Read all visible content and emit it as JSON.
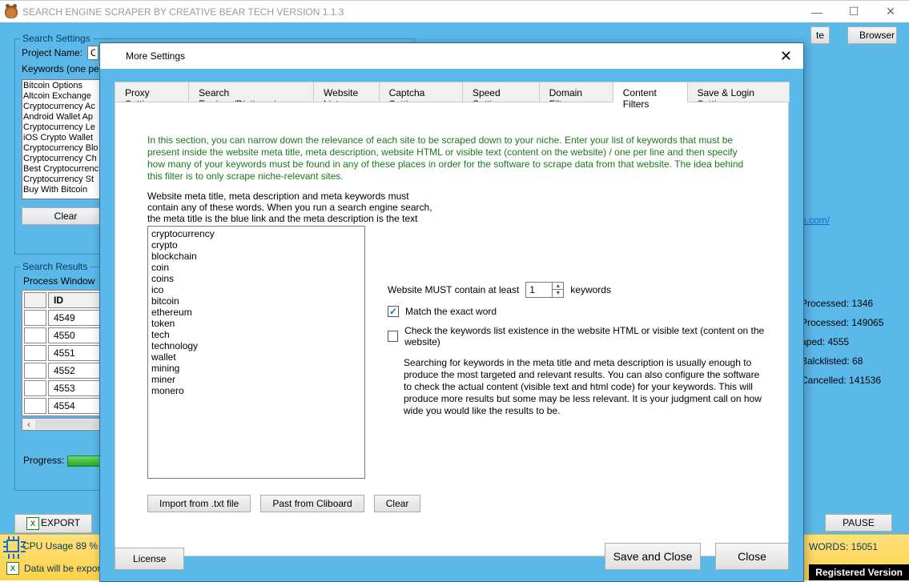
{
  "title": "SEARCH ENGINE SCRAPER BY CREATIVE BEAR TECH VERSION 1.1.3",
  "winbuttons": {
    "min": "—",
    "max": "☐",
    "close": "✕"
  },
  "topbuttons": {
    "te": "te",
    "browser": "Browser"
  },
  "search_settings": {
    "legend": "Search Settings",
    "project_label": "Project Name:",
    "project_value": "C",
    "keywords_label": "Keywords (one pe",
    "keywords": [
      "Bitcoin Options",
      "Altcoin Exchange",
      "Cryptocurrency Ac",
      "Android Wallet Ap",
      "Cryptocurrency Le",
      "iOS Crypto Wallet",
      "Cryptocurrency Blo",
      "Cryptocurrency Ch",
      "Best Cryptocurrenc",
      "Cryptocurrency St",
      "Buy With Bitcoin"
    ],
    "clear": "Clear"
  },
  "search_results": {
    "legend": "Search Results",
    "process": "Process Window",
    "idhdr": "ID",
    "ids": [
      "4549",
      "4550",
      "4551",
      "4552",
      "4553",
      "4554"
    ],
    "progress_label": "Progress:"
  },
  "rightstats": {
    "link": "h.com/",
    "processed_a": "Processed: 1346",
    "processed_b": "Processed: 149065",
    "scraped": "aped: 4555",
    "black": "Balcklisted: 68",
    "cancel": "Cancelled: 141536"
  },
  "export": "EXPORT",
  "pause": "PAUSE",
  "bottom": {
    "cpu": "CPU Usage 89 %",
    "export_path": "Data will be exported to ",
    "kw": "WORDS: 15051",
    "reg": "Registered Version"
  },
  "modal": {
    "title": "More Settings",
    "tabs": [
      "Proxy Settings",
      "Search Engines/Dictionaries",
      "Website List",
      "Captcha Settings",
      "Speed Settings",
      "Domain Filters",
      "Content Filters",
      "Save & Login Settings"
    ],
    "active_tab": 6,
    "green": "In this section, you can narrow down the relevance of each site to be scraped down to your niche. Enter your list of keywords that must be present inside the website meta title, meta description, website HTML or visible text (content on the website) / one per line and then specify how many of your keywords must be found in any of these places in order for the software to scrape data from that website. The idea behind this filter is to only scrape niche-relevant sites.",
    "metadesc": "Website meta title, meta description and meta keywords must contain any of these words. When you run a search engine search, the meta title is the blue link and the meta description is the text under it. Relevant",
    "filter_keywords": "cryptocurrency\ncrypto\nblockchain\ncoin\ncoins\nico\nbitcoin\nethereum\ntoken\ntech\ntechnology\nwallet\nmining\nminer\nmonero",
    "must_contain": "Website MUST contain at least",
    "num": "1",
    "kw_suffix": "keywords",
    "match_exact": "Match the exact word",
    "check_html": "Check the keywords list existence in the website HTML or visible text (content on the website)",
    "para": "Searching for keywords in the meta title and meta description is usually enough to produce the most targeted and relevant results. You can also configure the software to check the actual content (visible text and html code) for your keywords. This will produce more results but some may be less relevant. It is your judgment call on how wide you would like the results to be.",
    "import": "Import from .txt file",
    "paste": "Past from Cliboard",
    "clear": "Clear",
    "license": "License",
    "save": "Save and Close",
    "close": "Close"
  }
}
